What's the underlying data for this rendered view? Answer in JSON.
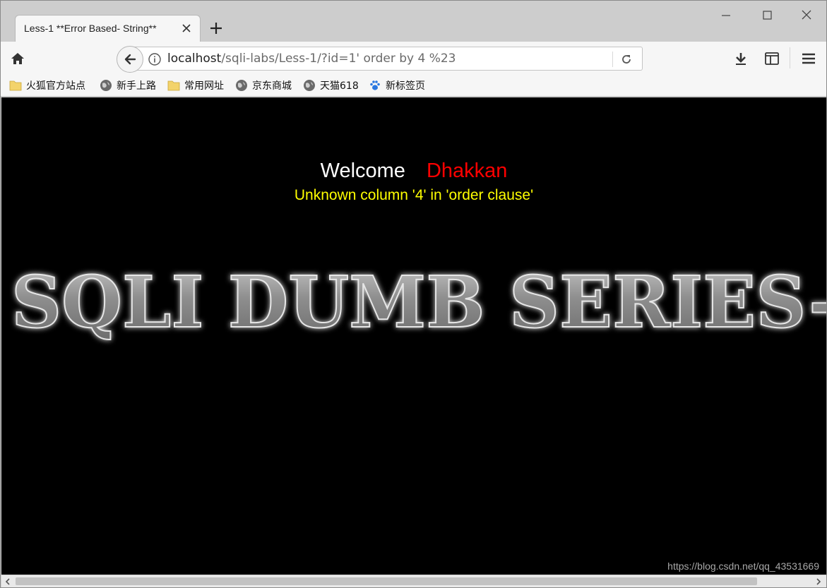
{
  "browser": {
    "tab": {
      "title": "Less-1 **Error Based- String**"
    },
    "url": {
      "host": "localhost",
      "path": "/sqli-labs/Less-1/?id=1' order by 4 %23"
    },
    "bookmarks": [
      {
        "label": "火狐官方站点",
        "icon": "folder-icon"
      },
      {
        "label": "新手上路",
        "icon": "globe-icon"
      },
      {
        "label": "常用网址",
        "icon": "folder-icon"
      },
      {
        "label": "京东商城",
        "icon": "globe-icon"
      },
      {
        "label": "天猫618",
        "icon": "globe-icon"
      },
      {
        "label": "新标签页",
        "icon": "paw-icon"
      }
    ]
  },
  "page": {
    "welcome": "Welcome",
    "user": "Dhakkan",
    "error": "Unknown column '4' in 'order clause'",
    "banner_text": "SQLI DUMB SERIES-",
    "watermark": "https://blog.csdn.net/qq_43531669"
  },
  "colors": {
    "background": "#000000",
    "welcome": "#ffffff",
    "user": "#ff0000",
    "error": "#ffff00"
  }
}
